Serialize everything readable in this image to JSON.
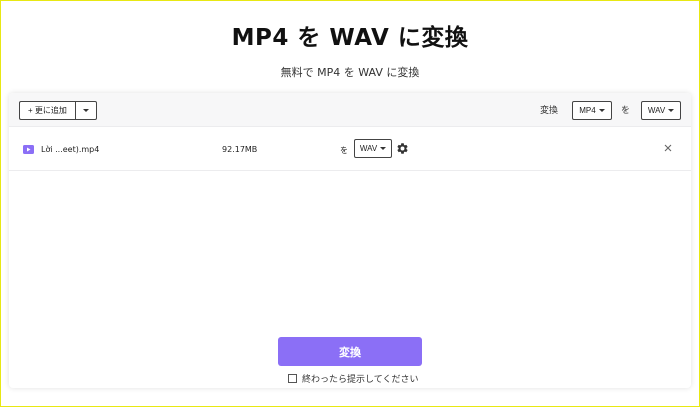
{
  "page": {
    "title": "MP4 を WAV に変換",
    "subtitle": "無料で MP4 を WAV に変換"
  },
  "toolbar": {
    "add_label": "+ 更に追加",
    "convert_label": "変換",
    "source_format": "MP4",
    "to_label": "を",
    "target_format": "WAV"
  },
  "file": {
    "name": "Lời ...eet).mp4",
    "size": "92.17MB",
    "to_label": "を",
    "format": "WAV"
  },
  "actions": {
    "convert_button": "変換",
    "notify_label": "終わったら提示してください"
  },
  "colors": {
    "accent": "#8b6ff6",
    "frame": "#e8e813"
  },
  "icons": {
    "file": "video-file-icon",
    "settings": "gear-icon",
    "remove": "close-icon",
    "dropdown": "chevron-down-icon"
  }
}
